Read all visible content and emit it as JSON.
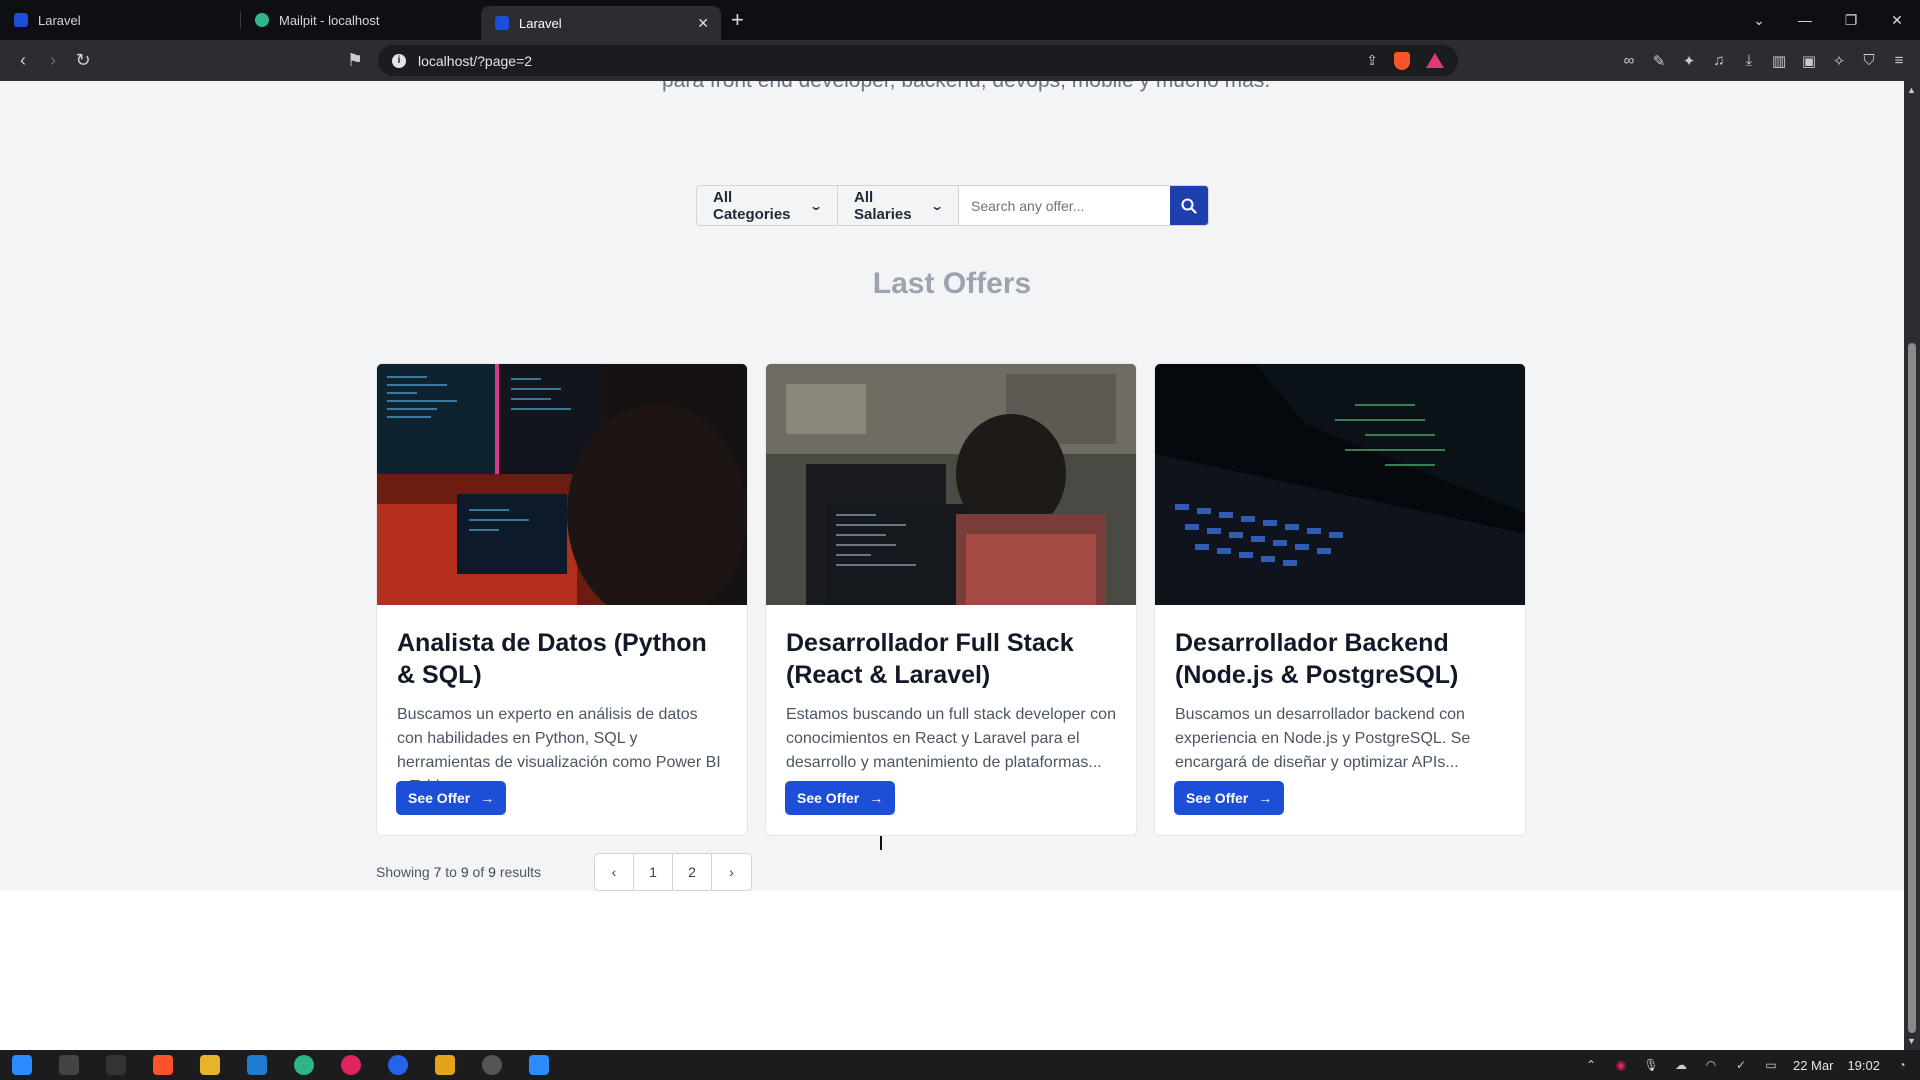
{
  "browser": {
    "tabs": [
      {
        "title": "Laravel",
        "active": false
      },
      {
        "title": "Mailpit - localhost",
        "active": false
      },
      {
        "title": "Laravel",
        "active": true
      }
    ],
    "url": "localhost/?page=2"
  },
  "page": {
    "cut_subtitle": "para front end developer, backend, devops, mobile y mucho más.",
    "filters": {
      "category_label": "All Categories",
      "salary_label": "All Salaries",
      "search_placeholder": "Search any offer..."
    },
    "section_title": "Last Offers",
    "offers": [
      {
        "title": "Analista de Datos (Python & SQL)",
        "description": "Buscamos un experto en análisis de datos con habilidades en Python, SQL y herramientas de visualización como Power BI o Tableau.",
        "button": "See Offer"
      },
      {
        "title": "Desarrollador Full Stack (React & Laravel)",
        "description": "Estamos buscando un full stack developer con conocimientos en React y Laravel para el desarrollo y mantenimiento de plataformas...",
        "button": "See Offer"
      },
      {
        "title": "Desarrollador Backend (Node.js & PostgreSQL)",
        "description": "Buscamos un desarrollador backend con experiencia en Node.js y PostgreSQL. Se encargará de diseñar y optimizar APIs...",
        "button": "See Offer"
      }
    ],
    "pagination": {
      "showing": "Showing",
      "from": "7",
      "to_word": "to",
      "to": "9",
      "of_word": "of",
      "total": "9",
      "results_word": "results",
      "pages": [
        "1",
        "2"
      ]
    }
  },
  "taskbar": {
    "date": "22 Mar",
    "time": "19:02"
  }
}
